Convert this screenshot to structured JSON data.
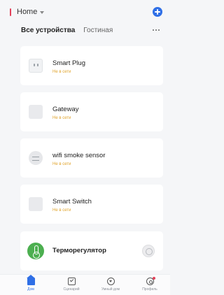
{
  "header": {
    "home_title": "Home",
    "tabs": [
      {
        "label": "Все устройства"
      },
      {
        "label": "Гостиная"
      }
    ]
  },
  "devices": [
    {
      "name": "Smart Plug",
      "status": "Не в сети",
      "icon": "plug-icon"
    },
    {
      "name": "Gateway",
      "status": "Не в сети",
      "icon": "gateway-icon"
    },
    {
      "name": "wifi smoke sensor",
      "status": "Не в сети",
      "icon": "smoke-sensor-icon"
    },
    {
      "name": "Smart Switch",
      "status": "Не в сети",
      "icon": "switch-icon"
    },
    {
      "name": "Терморегулятор",
      "icon": "thermostat-icon"
    }
  ],
  "nav": [
    {
      "label": "Дом",
      "icon": "home-icon"
    },
    {
      "label": "Сценарий",
      "icon": "scene-icon"
    },
    {
      "label": "Умный дом",
      "icon": "smart-icon"
    },
    {
      "label": "Профиль",
      "icon": "profile-icon"
    }
  ],
  "colors": {
    "accent": "#2f6fe6",
    "offline": "#e0a32a",
    "thermostat": "#4caf50",
    "marker": "#e2415a"
  }
}
